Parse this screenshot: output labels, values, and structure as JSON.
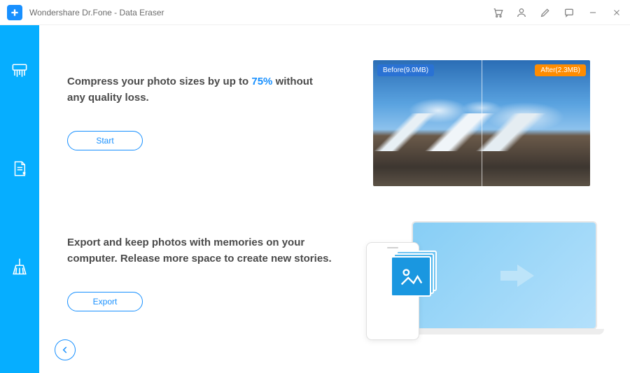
{
  "titlebar": {
    "title": "Wondershare Dr.Fone - Data Eraser"
  },
  "section1": {
    "headline_before": "Compress your photo sizes by up to ",
    "headline_highlight": "75%",
    "headline_after": " without any quality loss.",
    "button": "Start",
    "before_label": "Before(9.0MB)",
    "after_label": "After(2.3MB)"
  },
  "section2": {
    "headline": "Export and keep photos with memories on your computer. Release more space to create new stories.",
    "button": "Export"
  }
}
